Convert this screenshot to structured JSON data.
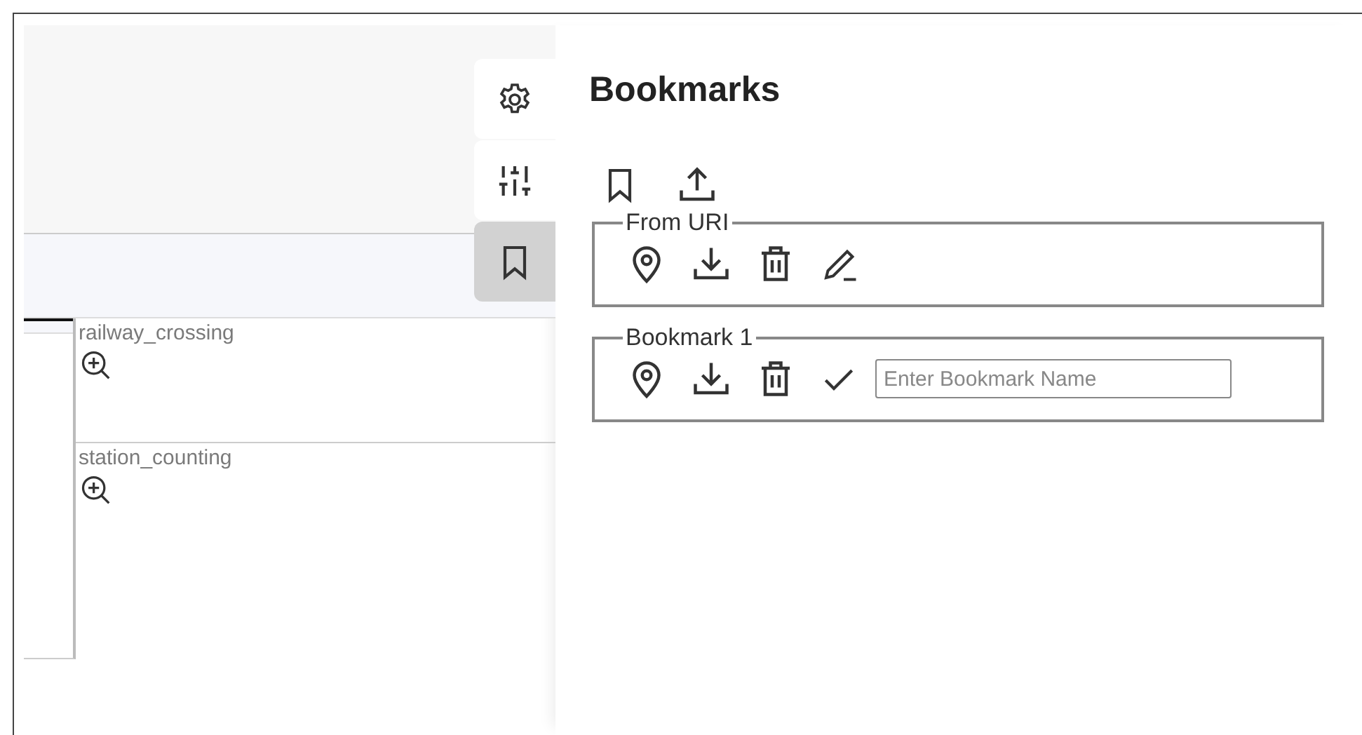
{
  "side_tabs": [
    {
      "kind": "settings",
      "selected": false
    },
    {
      "kind": "sliders",
      "selected": false
    },
    {
      "kind": "bookmark",
      "selected": true
    }
  ],
  "layers": [
    {
      "name": "railway_crossing"
    },
    {
      "name": "station_counting"
    }
  ],
  "panel": {
    "title": "Bookmarks"
  },
  "bookmarks": [
    {
      "legend": "From URI",
      "kind": "saved"
    },
    {
      "legend": "Bookmark 1",
      "kind": "new",
      "placeholder": "Enter Bookmark Name"
    }
  ]
}
